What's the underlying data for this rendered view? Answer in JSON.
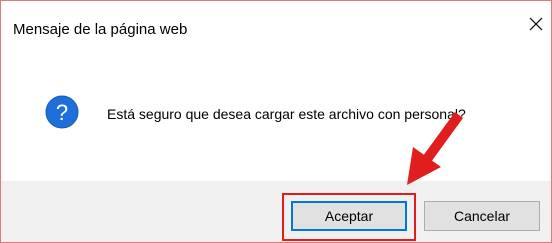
{
  "dialog": {
    "title": "Mensaje de la página web",
    "close_icon": "close-icon",
    "message": "Está seguro que desea cargar este archivo con personal?",
    "message_icon": "question-icon",
    "buttons": {
      "accept_label": "Aceptar",
      "cancel_label": "Cancelar"
    }
  },
  "annotations": {
    "highlight_color": "#e01e1e",
    "arrow_color": "#e01e1e",
    "arrow_target": "accept-button"
  },
  "colors": {
    "icon_blue": "#1e6fd9",
    "default_button_border": "#0078d7",
    "button_bar_bg": "#f0f0f0"
  }
}
